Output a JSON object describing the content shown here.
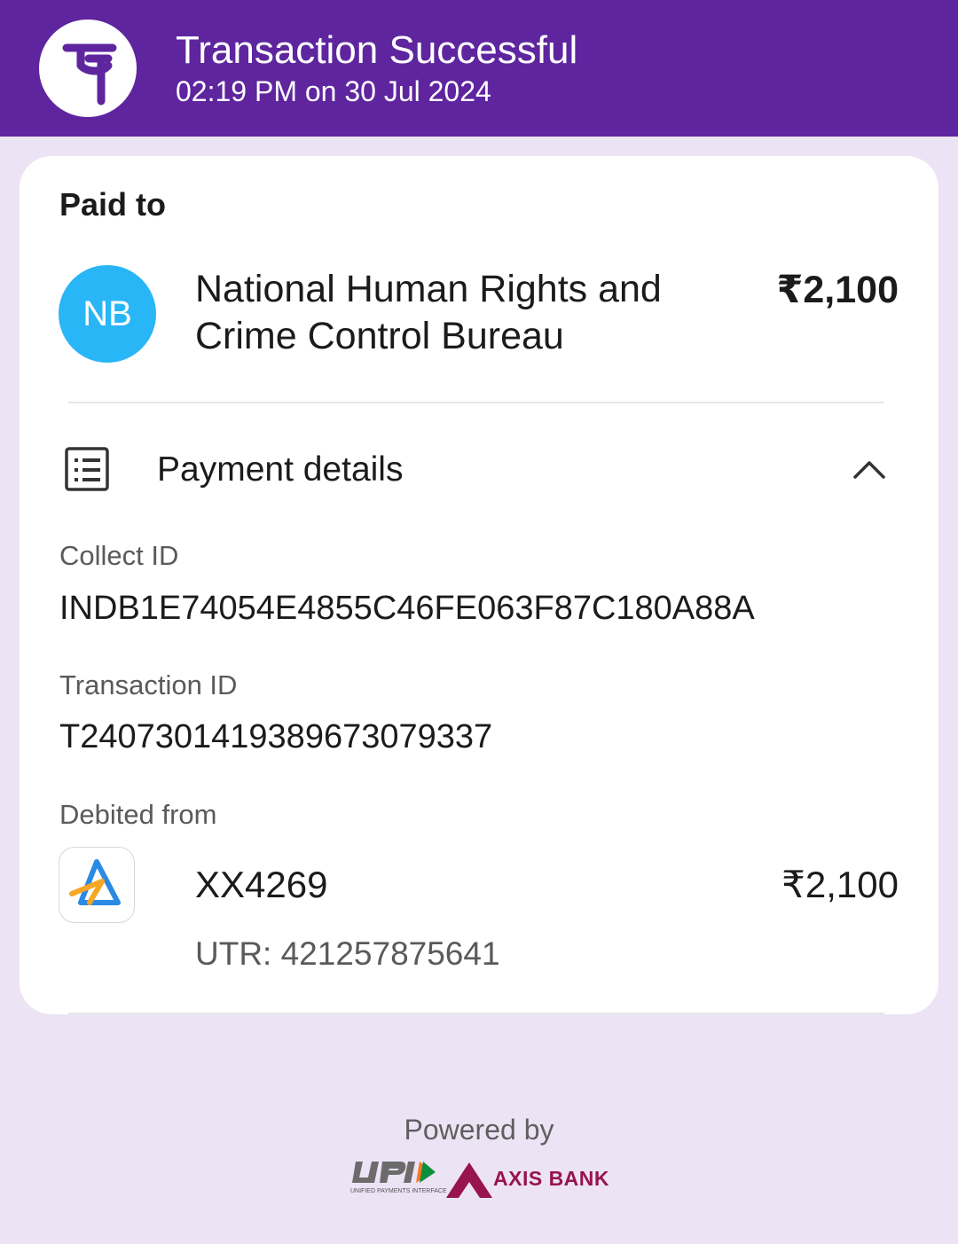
{
  "header": {
    "title": "Transaction Successful",
    "subtitle": "02:19 PM on 30 Jul 2024",
    "brand_icon": "phonepe-logo-icon",
    "bg_color": "#5f259f"
  },
  "payee": {
    "section_label": "Paid to",
    "avatar_initials": "NB",
    "avatar_color": "#29b6f6",
    "name": "National Human Rights and Crime Control Bureau",
    "amount": "₹2,100"
  },
  "payment_details": {
    "title": "Payment details",
    "icon": "receipt-list-icon",
    "toggle_icon": "chevron-up-icon",
    "collect_id_label": "Collect ID",
    "collect_id": "INDB1E74054E4855C46FE063F87C180A88A",
    "transaction_id_label": "Transaction ID",
    "transaction_id": "T2407301419389673079337",
    "debited_from_label": "Debited from",
    "bank_icon": "sbi-bank-logo-icon",
    "account_number": "XX4269",
    "debit_amount": "₹2,100",
    "utr": "UTR: 421257875641"
  },
  "footer": {
    "powered_by": "Powered by",
    "upi_subtext": "UNIFIED PAYMENTS INTERFACE",
    "axis_bank_label": "AXIS BANK"
  }
}
